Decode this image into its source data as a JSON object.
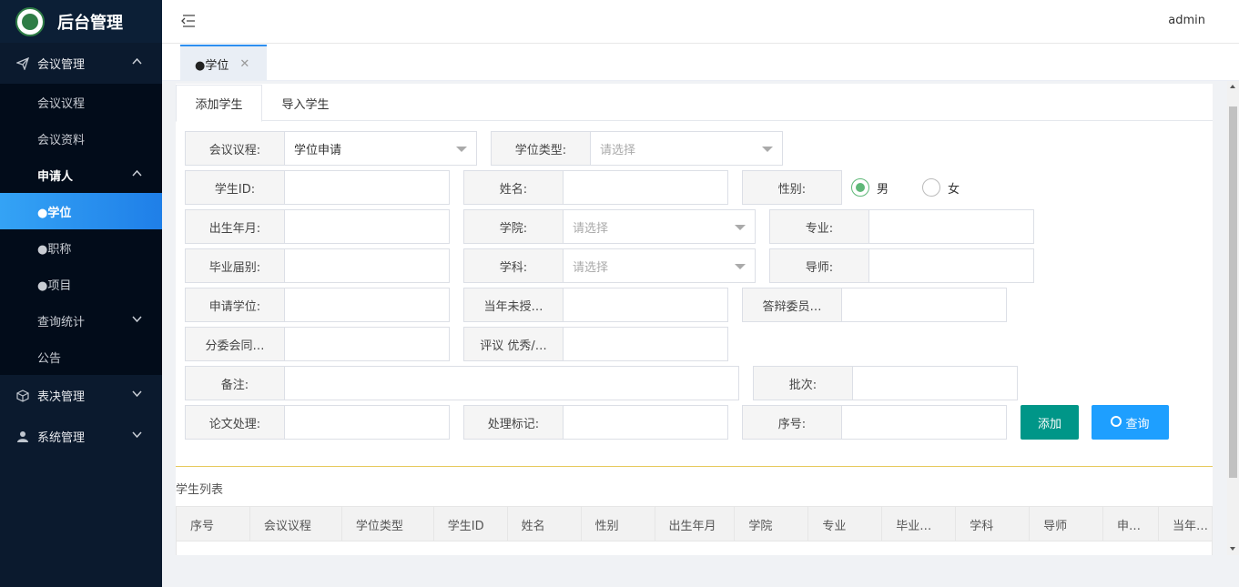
{
  "app": {
    "title": "后台管理",
    "user": "admin"
  },
  "sidebar": {
    "meeting": {
      "label": "会议管理",
      "items": {
        "agenda": "会议议程",
        "docs": "会议资料"
      }
    },
    "applicant": {
      "label": "申请人",
      "items": {
        "degree": "●学位",
        "title": "●职称",
        "project": "●项目"
      }
    },
    "stats": "查询统计",
    "notice": "公告",
    "vote": "表决管理",
    "system": "系统管理"
  },
  "tags": {
    "current": "●学位",
    "close": "✕"
  },
  "tabs": {
    "add": "添加学生",
    "import": "导入学生"
  },
  "form": {
    "agenda": {
      "label": "会议议程:",
      "value": "学位申请"
    },
    "degree_type": {
      "label": "学位类型:",
      "placeholder": "请选择"
    },
    "student_id": {
      "label": "学生ID:",
      "value": ""
    },
    "name": {
      "label": "姓名:",
      "value": ""
    },
    "gender": {
      "label": "性别:",
      "options": [
        "男",
        "女"
      ],
      "selected": "男"
    },
    "birth": {
      "label": "出生年月:",
      "value": ""
    },
    "college": {
      "label": "学院:",
      "placeholder": "请选择"
    },
    "major": {
      "label": "专业:",
      "value": ""
    },
    "grad_year": {
      "label": "毕业届别:",
      "value": ""
    },
    "subject": {
      "label": "学科:",
      "placeholder": "请选择"
    },
    "tutor": {
      "label": "导师:",
      "value": ""
    },
    "apply_degree": {
      "label": "申请学位:",
      "value": ""
    },
    "not_granted": {
      "label": "当年未授…",
      "value": ""
    },
    "defense": {
      "label": "答辩委员…",
      "value": ""
    },
    "subcommittee": {
      "label": "分委会同…",
      "value": ""
    },
    "review": {
      "label": "评议 优秀/…",
      "value": ""
    },
    "remark": {
      "label": "备注:",
      "value": ""
    },
    "batch": {
      "label": "批次:",
      "value": ""
    },
    "thesis": {
      "label": "论文处理:",
      "value": ""
    },
    "mark": {
      "label": "处理标记:",
      "value": ""
    },
    "seq": {
      "label": "序号:",
      "value": ""
    }
  },
  "buttons": {
    "add": "添加",
    "query": "查询"
  },
  "list": {
    "title": "学生列表",
    "columns": [
      "序号",
      "会议议程",
      "学位类型",
      "学生ID",
      "姓名",
      "性别",
      "出生年月",
      "学院",
      "专业",
      "毕业…",
      "学科",
      "导师",
      "申…",
      "当年…"
    ]
  },
  "colors": {
    "sidebar": "#0b1a2e",
    "active": "#1f7fe8",
    "add_button": "#009688",
    "query_button": "#1e9fff",
    "radio_on": "#5fb878"
  }
}
